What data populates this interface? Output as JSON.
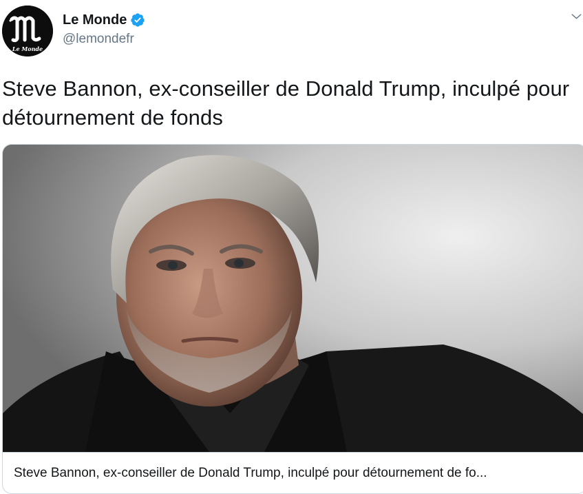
{
  "author": {
    "display_name": "Le Monde",
    "handle": "@lemondefr",
    "verified": true,
    "avatar_icon": "le-monde-logo",
    "avatar_logo_text": "Le Monde"
  },
  "tweet": {
    "text": "Steve Bannon, ex-conseiller de Donald Trump, inculpé pour détournement de fonds"
  },
  "card": {
    "image_subject": "portrait-photo",
    "title": "Steve Bannon, ex-conseiller de Donald Trump, inculpé pour détournement de fo..."
  },
  "icons": {
    "verified": "verified-badge-icon",
    "more": "chevron-down-icon"
  },
  "colors": {
    "verified_blue": "#1da1f2",
    "text_primary": "#14171a",
    "text_secondary": "#657786",
    "border": "#ccd6dd"
  }
}
